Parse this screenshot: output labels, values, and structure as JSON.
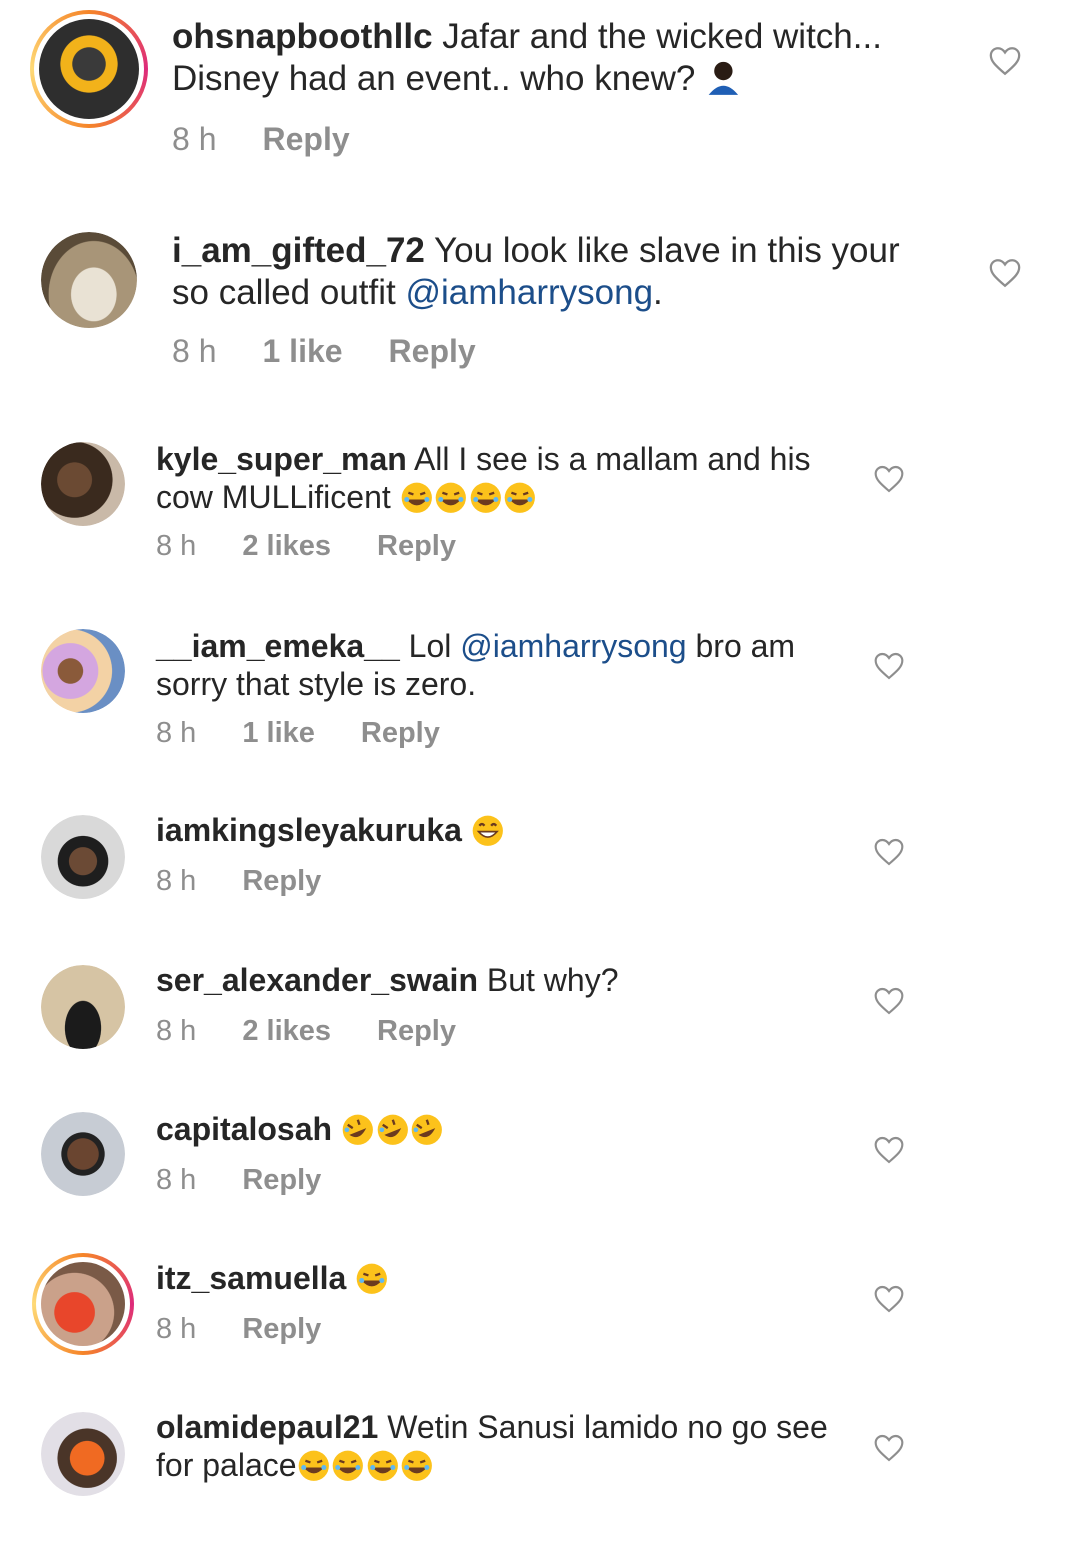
{
  "comments": [
    {
      "username": "ohsnapboothllc",
      "text_before": " Jafar and the wicked witch... Disney had an event.. who knew? ",
      "mention": "",
      "text_after": "",
      "emoji": [
        "person-emoji"
      ],
      "time": "8 h",
      "likes": "",
      "reply": "Reply"
    },
    {
      "username": "i_am_gifted_72",
      "text_before": " You look like slave in this your so called outfit  ",
      "mention": "@iamharrysong",
      "text_after": ".",
      "emoji": [],
      "time": "8 h",
      "likes": "1 like",
      "reply": "Reply"
    },
    {
      "username": "kyle_super_man",
      "text_before": " All I see is a mallam and his cow  MULLificent ",
      "mention": "",
      "text_after": "",
      "emoji": [
        "laugh-emoji",
        "laugh-emoji",
        "laugh-emoji",
        "laugh-emoji"
      ],
      "time": "8 h",
      "likes": "2 likes",
      "reply": "Reply"
    },
    {
      "username": "__iam_emeka__",
      "text_before": " Lol ",
      "mention": "@iamharrysong",
      "text_after": " bro am sorry that style is zero.",
      "emoji": [],
      "time": "8 h",
      "likes": "1 like",
      "reply": "Reply"
    },
    {
      "username": "iamkingsleyakuruka",
      "text_before": " ",
      "mention": "",
      "text_after": "",
      "emoji": [
        "grin-emoji"
      ],
      "time": "8 h",
      "likes": "",
      "reply": "Reply"
    },
    {
      "username": "ser_alexander_swain",
      "text_before": " But why?",
      "mention": "",
      "text_after": "",
      "emoji": [],
      "time": "8 h",
      "likes": "2 likes",
      "reply": "Reply"
    },
    {
      "username": "capitalosah",
      "text_before": " ",
      "mention": "",
      "text_after": "",
      "emoji": [
        "rofl-emoji",
        "rofl-emoji",
        "rofl-emoji"
      ],
      "time": "8 h",
      "likes": "",
      "reply": "Reply"
    },
    {
      "username": "itz_samuella",
      "text_before": " ",
      "mention": "",
      "text_after": "",
      "emoji": [
        "laugh-emoji"
      ],
      "time": "8 h",
      "likes": "",
      "reply": "Reply"
    },
    {
      "username": "olamidepaul21",
      "text_before": " Wetin Sanusi lamido no go see for palace",
      "mention": "",
      "text_after": "",
      "emoji": [
        "laugh-emoji",
        "laugh-emoji",
        "laugh-emoji",
        "laugh-emoji"
      ],
      "time": "8 h",
      "likes": "",
      "reply": "Reply"
    }
  ],
  "colors": {
    "text": "#262626",
    "meta": "#8e8e8e",
    "mention": "#1c4e8a",
    "heart_stroke": "#8e8e8e"
  }
}
